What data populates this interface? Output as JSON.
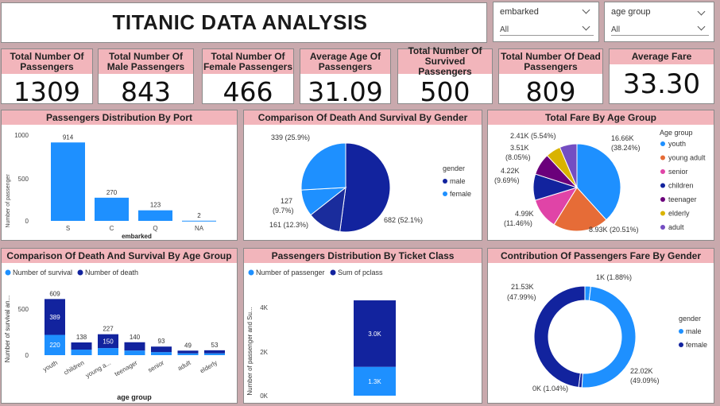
{
  "title": "TITANIC DATA ANALYSIS",
  "filters": {
    "embarked": {
      "label": "embarked",
      "value": "All"
    },
    "age_group": {
      "label": "age group",
      "value": "All"
    }
  },
  "kpis": [
    {
      "label": "Total Number Of Passengers",
      "value": "1309"
    },
    {
      "label": "Total Number Of Male Passengers",
      "value": "843"
    },
    {
      "label": "Total Number Of Female Passengers",
      "value": "466"
    },
    {
      "label": "Average Age Of Passengers",
      "value": "31.09"
    },
    {
      "label": "Total Number Of Survived Passengers",
      "value": "500"
    },
    {
      "label": "Total Number Of Dead Passengers",
      "value": "809"
    },
    {
      "label": "Average Fare",
      "value": "33.30"
    }
  ],
  "colors": {
    "light_blue": "#1e90ff",
    "dark_blue": "#1a2c9c",
    "navy": "#12239e",
    "orange": "#e66c37",
    "pink": "#e044a7",
    "purple": "#744ec2",
    "gold": "#d9b300",
    "violet": "#6b007b",
    "header_pink": "#f2b5bb"
  },
  "charts": {
    "port": {
      "title": "Passengers Distribution By Port",
      "chart_data": {
        "type": "bar",
        "categories": [
          "S",
          "C",
          "Q",
          "NA"
        ],
        "values": [
          914,
          270,
          123,
          2
        ],
        "data_labels": [
          "914",
          "270",
          "123",
          "2"
        ],
        "xlabel": "embarked",
        "ylabel": "Number of passenger",
        "yticks": [
          "0",
          "500",
          "1000"
        ],
        "ylim": [
          0,
          1000
        ]
      }
    },
    "gender_survival": {
      "title": "Comparison Of Death And Survival By Gender",
      "chart_data": {
        "type": "pie",
        "legend_title": "gender",
        "legend": [
          "male",
          "female"
        ],
        "slices": [
          {
            "label": "682 (52.1%)",
            "value": 682
          },
          {
            "label": "161 (12.3%)",
            "value": 161
          },
          {
            "label": "127 (9.7%)",
            "value": 127
          },
          {
            "label": "339 (25.9%)",
            "value": 339
          }
        ],
        "label_127": "127",
        "label_127_pct": "(9.7%)"
      }
    },
    "fare_age": {
      "title": "Total Fare By Age Group",
      "chart_data": {
        "type": "pie",
        "legend_title": "Age group",
        "legend": [
          "youth",
          "young adult",
          "senior",
          "children",
          "teenager",
          "elderly",
          "adult"
        ],
        "slices": [
          {
            "label_a": "16.66K",
            "label_b": "(38.24%)",
            "value": 16.66
          },
          {
            "label_a": "8.93K (20.51%)",
            "label_b": "",
            "value": 8.93
          },
          {
            "label_a": "4.99K",
            "label_b": "(11.46%)",
            "value": 4.99
          },
          {
            "label_a": "4.22K",
            "label_b": "(9.69%)",
            "value": 4.22
          },
          {
            "label_a": "3.51K",
            "label_b": "(8.05%)",
            "value": 3.51
          },
          {
            "label_a": "2.41K (5.54%)",
            "label_b": "",
            "value": 2.41
          },
          {
            "label_a": "",
            "label_b": "",
            "value": 2.79
          }
        ]
      }
    },
    "age_survival": {
      "title": "Comparison Of Death And Survival By Age Group",
      "chart_data": {
        "type": "bar",
        "legend": [
          "Number of survival",
          "Number of death"
        ],
        "categories": [
          "youth",
          "children",
          "young a...",
          "teenager",
          "senior",
          "adult",
          "elderly"
        ],
        "survival": [
          220,
          60,
          77,
          50,
          33,
          20,
          20
        ],
        "death": [
          389,
          78,
          150,
          90,
          60,
          29,
          33
        ],
        "totals": [
          "609",
          "138",
          "227",
          "140",
          "93",
          "49",
          "53"
        ],
        "inner_labels": {
          "youth_survival": "220",
          "youth_death": "389",
          "young_death": "150"
        },
        "xlabel": "age group",
        "ylabel": "Number of survival an...",
        "yticks": [
          "0",
          "500"
        ]
      }
    },
    "ticket_class": {
      "title": "Passengers Distribution By Ticket Class",
      "chart_data": {
        "type": "bar",
        "legend": [
          "Number of passenger",
          "Sum of pclass"
        ],
        "series": [
          {
            "name": "Number of passenger",
            "values": [
              1309
            ],
            "label": "1.3K"
          },
          {
            "name": "Sum of pclass",
            "values": [
              3014
            ],
            "label": "3.0K"
          }
        ],
        "ylabel": "Number of passenger and Su...",
        "yticks": [
          "0K",
          "2K",
          "4K"
        ],
        "ylim": [
          0,
          4500
        ]
      }
    },
    "fare_gender": {
      "title": "Contribution Of Passengers Fare By Gender",
      "chart_data": {
        "type": "pie",
        "legend_title": "gender",
        "legend": [
          "male",
          "female"
        ],
        "labels": {
          "top": "1K (1.88%)",
          "left_a": "21.53K",
          "left_b": "(47.99%)",
          "right_a": "22.02K",
          "right_b": "(49.09%)",
          "bottom": "0K (1.04%)"
        },
        "slices": [
          0.83,
          22.02,
          0.46,
          21.53
        ]
      }
    }
  }
}
